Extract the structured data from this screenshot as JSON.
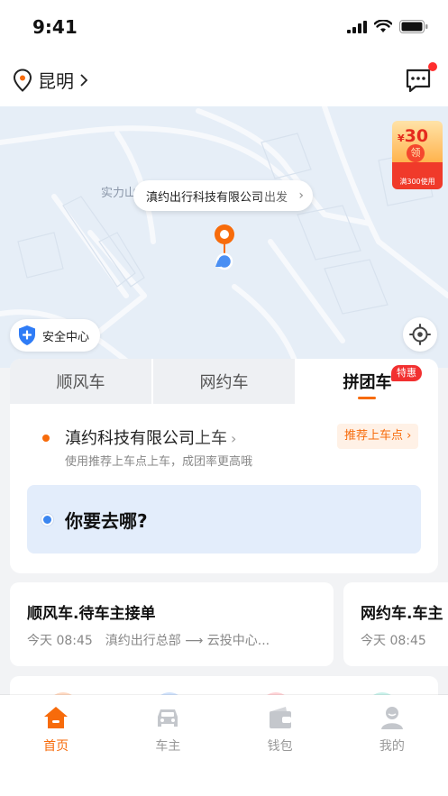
{
  "status_bar": {
    "time": "9:41"
  },
  "header": {
    "city": "昆明"
  },
  "map": {
    "area_label": "实力山",
    "pickup_place": "滇约出行科技有限公司",
    "pickup_action": "出发"
  },
  "coupon": {
    "currency": "¥",
    "amount": "30",
    "seal": "领",
    "condition": "满300使用"
  },
  "safety": {
    "label": "安全中心"
  },
  "booking": {
    "tabs": [
      {
        "label": "顺风车"
      },
      {
        "label": "网约车"
      },
      {
        "label": "拼团车",
        "badge": "特惠"
      }
    ],
    "pickup_title": "滇约科技有限公司",
    "pickup_suffix": "上车",
    "pickup_hint": "使用推荐上车点上车，成团率更高哦",
    "recommend_label": "推荐上车点",
    "destination_prompt": "你要去哪?"
  },
  "orders": [
    {
      "title": "顺风车.待车主接单",
      "time": "今天 08:45",
      "route": "滇约出行总部 ⟶ 云投中心..."
    },
    {
      "title": "网约车.车主",
      "time": "今天 08:45",
      "route": ""
    }
  ],
  "tabbar": [
    {
      "label": "首页"
    },
    {
      "label": "车主"
    },
    {
      "label": "钱包"
    },
    {
      "label": "我的"
    }
  ],
  "colors": {
    "accent": "#f76b0b",
    "blue": "#3b86f0",
    "badge": "#f23030"
  }
}
